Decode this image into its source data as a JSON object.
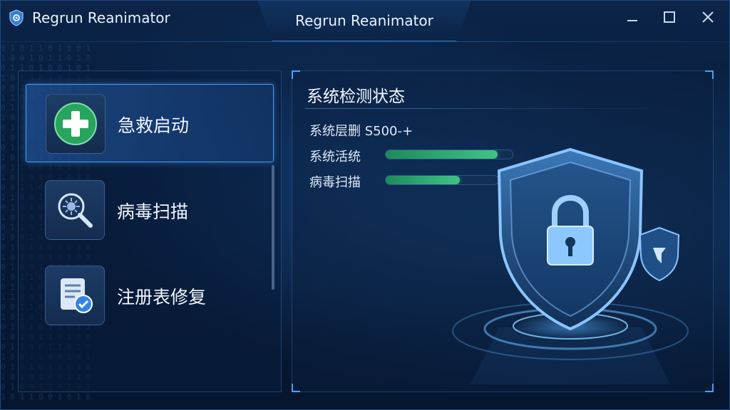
{
  "window": {
    "app_name": "Regrun Reanimator",
    "center_title": "Regrun Reanimator"
  },
  "icons": {
    "app_logo": "shield-gear-icon",
    "minimize": "minimize-icon",
    "maximize": "maximize-icon",
    "close": "close-icon"
  },
  "menu": {
    "items": [
      {
        "label": "急救启动",
        "icon": "medical-cross-icon",
        "active": true
      },
      {
        "label": "病毒扫描",
        "icon": "virus-scan-icon",
        "active": false
      },
      {
        "label": "注册表修复",
        "icon": "registry-check-icon",
        "active": false
      }
    ]
  },
  "status": {
    "title": "系统检测状态",
    "rows": [
      {
        "label": "系统层删 S500-+"
      },
      {
        "label": "系统活统",
        "progress": 0.88
      },
      {
        "label": "病毒扫描",
        "progress": 0.66
      }
    ]
  },
  "colors": {
    "accent": "#4d9cf0",
    "progress": "#3fc486",
    "background": "#071b38"
  }
}
